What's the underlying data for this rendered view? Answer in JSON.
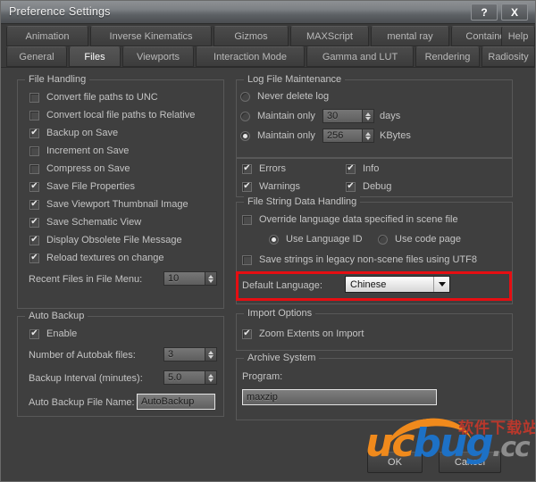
{
  "window": {
    "title": "Preference Settings",
    "help_button": "?",
    "close_button": "X"
  },
  "tabs": {
    "row1": [
      {
        "label": "Animation",
        "active": false
      },
      {
        "label": "Inverse Kinematics",
        "active": false
      },
      {
        "label": "Gizmos",
        "active": false
      },
      {
        "label": "MAXScript",
        "active": false
      },
      {
        "label": "mental ray",
        "active": false
      },
      {
        "label": "Containers",
        "active": false
      },
      {
        "label": "Help",
        "active": false
      }
    ],
    "row2": [
      {
        "label": "General",
        "active": false
      },
      {
        "label": "Files",
        "active": true
      },
      {
        "label": "Viewports",
        "active": false
      },
      {
        "label": "Interaction Mode",
        "active": false
      },
      {
        "label": "Gamma and LUT",
        "active": false
      },
      {
        "label": "Rendering",
        "active": false
      },
      {
        "label": "Radiosity",
        "active": false
      }
    ]
  },
  "file_handling": {
    "title": "File Handling",
    "checkboxes": [
      {
        "label": "Convert file paths to UNC",
        "checked": false
      },
      {
        "label": "Convert local file paths to Relative",
        "checked": false
      },
      {
        "label": "Backup on Save",
        "checked": true
      },
      {
        "label": "Increment on Save",
        "checked": false
      },
      {
        "label": "Compress on Save",
        "checked": false
      },
      {
        "label": "Save File Properties",
        "checked": true
      },
      {
        "label": "Save Viewport Thumbnail Image",
        "checked": true
      },
      {
        "label": "Save Schematic View",
        "checked": true
      },
      {
        "label": "Display Obsolete File Message",
        "checked": true
      },
      {
        "label": "Reload textures on change",
        "checked": true
      }
    ],
    "recent_files_label": "Recent Files in File Menu:",
    "recent_files_value": "10"
  },
  "auto_backup": {
    "title": "Auto Backup",
    "enable_label": "Enable",
    "enable_checked": true,
    "num_files_label": "Number of Autobak files:",
    "num_files_value": "3",
    "interval_label": "Backup Interval (minutes):",
    "interval_value": "5.0",
    "filename_label": "Auto Backup File Name:",
    "filename_value": "AutoBackup"
  },
  "log_file_maintenance": {
    "title": "Log File Maintenance",
    "option_never": "Never delete log",
    "option_days": "Maintain only",
    "days_value": "30",
    "days_unit": "days",
    "option_kbytes": "Maintain only",
    "kbytes_value": "256",
    "kbytes_unit": "KBytes",
    "selected": "kbytes",
    "levels": [
      {
        "label": "Errors",
        "checked": true
      },
      {
        "label": "Info",
        "checked": true
      },
      {
        "label": "Warnings",
        "checked": true
      },
      {
        "label": "Debug",
        "checked": true
      }
    ]
  },
  "file_string_data": {
    "title": "File String Data Handling",
    "override_label": "Override language data specified in scene file",
    "override_checked": false,
    "use_language_id": "Use Language ID",
    "use_code_page": "Use code page",
    "language_mode_selected": "language_id",
    "legacy_utf8_label": "Save strings in legacy non-scene files using UTF8",
    "legacy_utf8_checked": false,
    "default_language_label": "Default Language:",
    "default_language_value": "Chinese",
    "highlight_color": "#e60e12"
  },
  "import_options": {
    "title": "Import Options",
    "zoom_extents_label": "Zoom Extents on Import",
    "zoom_extents_checked": true
  },
  "archive_system": {
    "title": "Archive System",
    "program_label": "Program:",
    "program_value": "maxzip"
  },
  "dialog_buttons": {
    "ok": "OK",
    "cancel": "Cancel"
  },
  "watermark": {
    "u": "u",
    "c": "c",
    "bug": "bug",
    "suffix": ".cc",
    "chinese": "软件下载站"
  }
}
